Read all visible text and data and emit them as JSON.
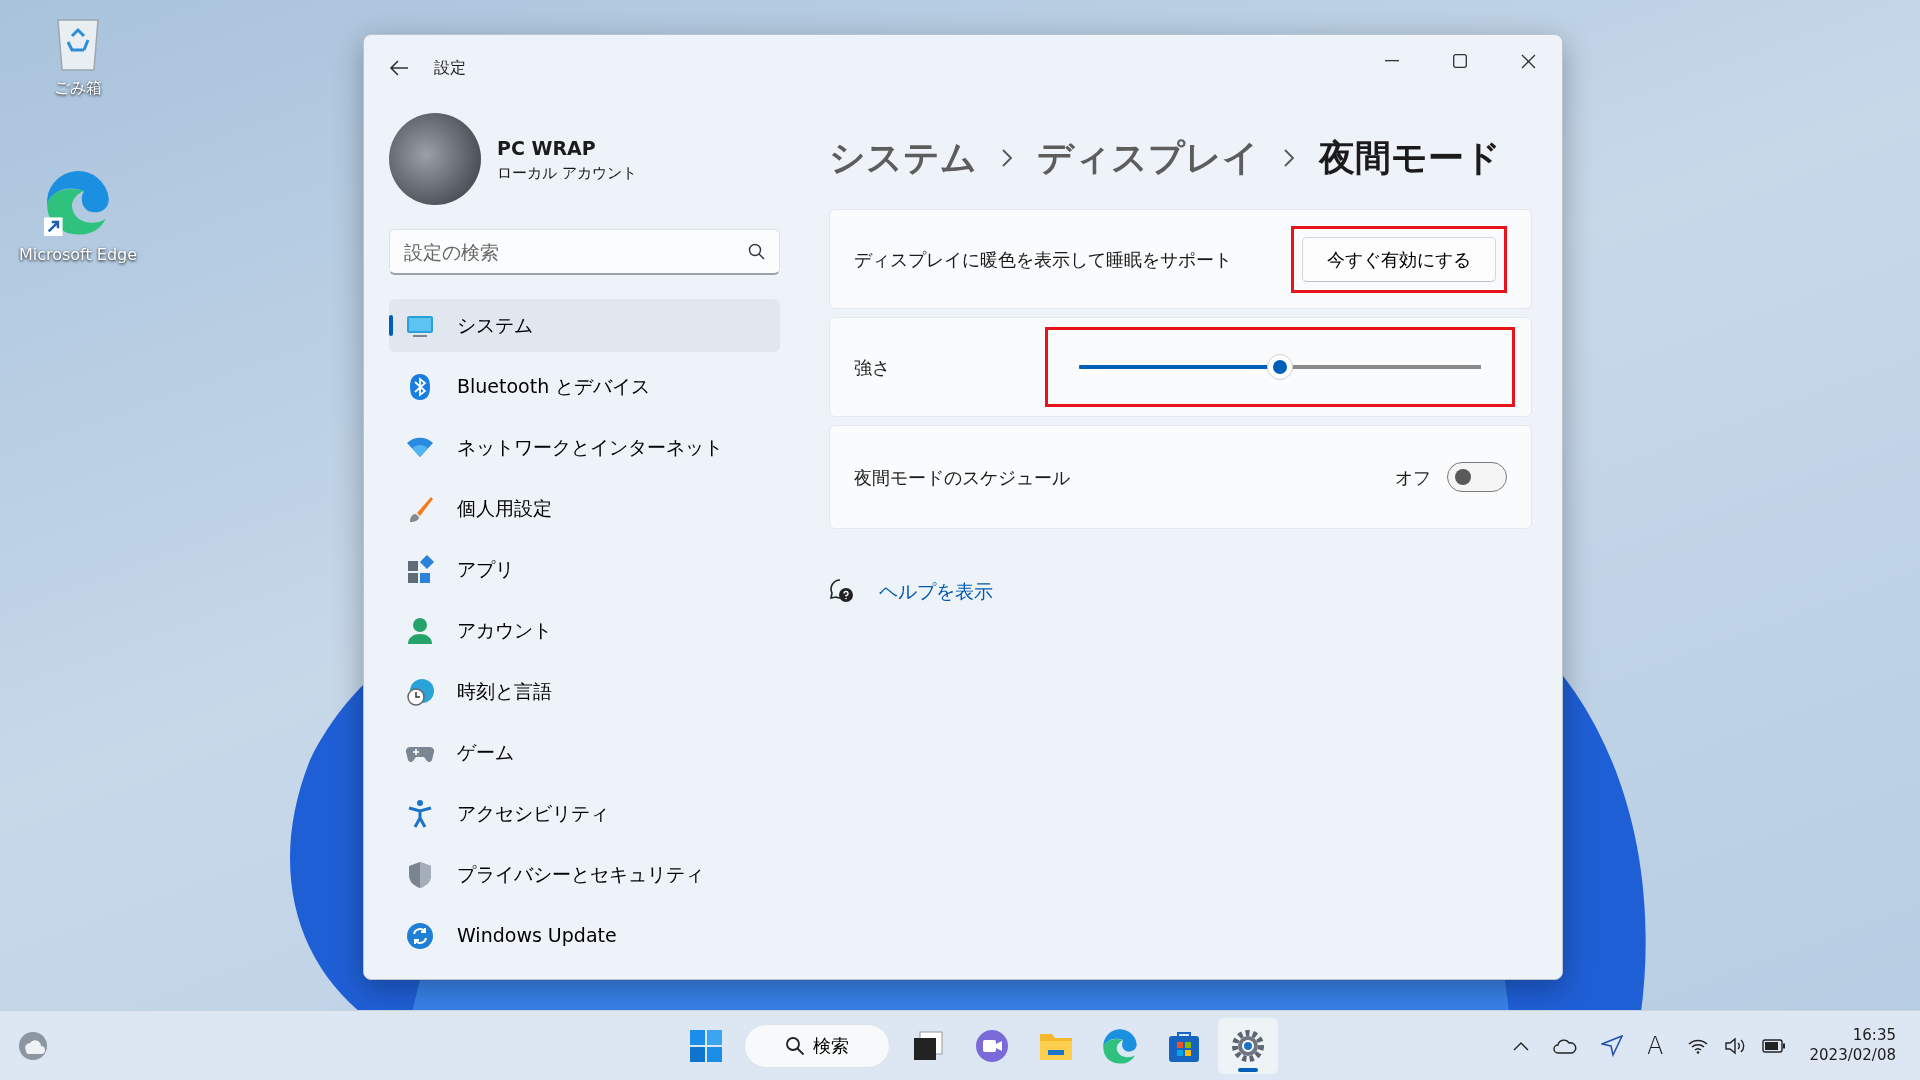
{
  "desktop_icons": [
    {
      "kind": "recycle",
      "label": "ごみ箱"
    },
    {
      "kind": "edge",
      "label": "Microsoft Edge"
    }
  ],
  "window": {
    "title": "設定"
  },
  "account": {
    "name": "PC WRAP",
    "type": "ローカル アカウント"
  },
  "search": {
    "placeholder": "設定の検索"
  },
  "nav_items": [
    {
      "label": "システム",
      "selected": true
    },
    {
      "label": "Bluetooth とデバイス",
      "selected": false
    },
    {
      "label": "ネットワークとインターネット",
      "selected": false
    },
    {
      "label": "個人用設定",
      "selected": false
    },
    {
      "label": "アプリ",
      "selected": false
    },
    {
      "label": "アカウント",
      "selected": false
    },
    {
      "label": "時刻と言語",
      "selected": false
    },
    {
      "label": "ゲーム",
      "selected": false
    },
    {
      "label": "アクセシビリティ",
      "selected": false
    },
    {
      "label": "プライバシーとセキュリティ",
      "selected": false
    },
    {
      "label": "Windows Update",
      "selected": false
    }
  ],
  "breadcrumb": [
    "システム",
    "ディスプレイ",
    "夜間モード"
  ],
  "settings": [
    {
      "kind": "button",
      "label": "ディスプレイに暖色を表示して睡眠をサポート",
      "button": "今すぐ有効にする",
      "highlighted": true
    },
    {
      "kind": "slider",
      "label": "強さ",
      "level": 0.5,
      "highlighted": true
    },
    {
      "kind": "toggle",
      "label": "夜間モードのスケジュール",
      "state_text": "オフ",
      "on": false,
      "highlighted": false
    }
  ],
  "help_link": "ヘルプを表示",
  "taskbar": {
    "search_label": "検索",
    "apps": [
      {
        "kind": "start",
        "selected": false
      },
      {
        "kind": "search",
        "selected": false
      },
      {
        "kind": "taskview",
        "selected": false
      },
      {
        "kind": "chat",
        "selected": false
      },
      {
        "kind": "explorer",
        "selected": false
      },
      {
        "kind": "edge",
        "selected": false
      },
      {
        "kind": "store",
        "selected": false
      },
      {
        "kind": "settings",
        "selected": true
      }
    ]
  },
  "tray": {
    "ime": "A",
    "time": "16:35",
    "date": "2023/02/08"
  }
}
